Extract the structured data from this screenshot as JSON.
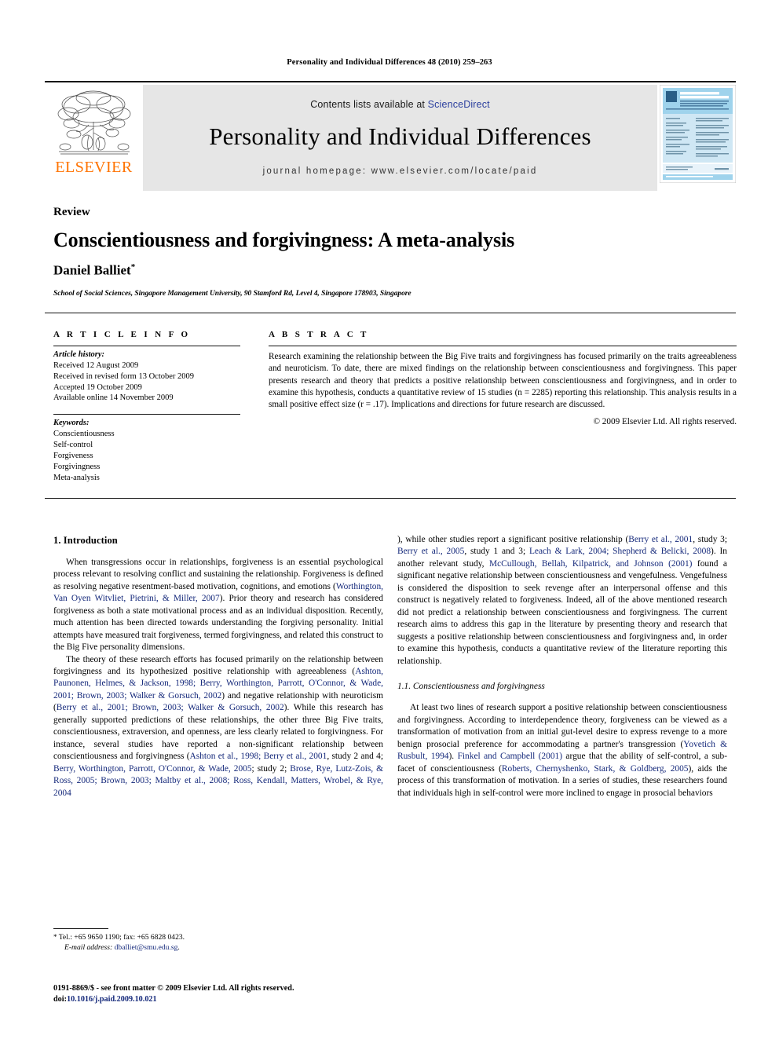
{
  "running_head": "Personality and Individual Differences 48 (2010) 259–263",
  "masthead": {
    "publisher_name": "ELSEVIER",
    "contents_prefix": "Contents lists available at ",
    "sciencedirect": "ScienceDirect",
    "journal_title": "Personality and Individual Differences",
    "homepage": "journal homepage: www.elsevier.com/locate/paid",
    "cover": {
      "title_line1": "PERSONALITY AND",
      "title_line2": "INDIVIDUAL DIFFERENCES",
      "accent_color": "#9fd3ec"
    }
  },
  "article": {
    "doc_type": "Review",
    "title": "Conscientiousness and forgivingness: A meta-analysis",
    "author": "Daniel Balliet",
    "author_marker": "*",
    "affiliation": "School of Social Sciences, Singapore Management University, 90 Stamford Rd, Level 4, Singapore 178903, Singapore"
  },
  "info": {
    "heading": "A R T I C L E   I N F O",
    "history_label": "Article history:",
    "history": [
      "Received 12 August 2009",
      "Received in revised form 13 October 2009",
      "Accepted 19 October 2009",
      "Available online 14 November 2009"
    ],
    "keywords_label": "Keywords:",
    "keywords": [
      "Conscientiousness",
      "Self-control",
      "Forgiveness",
      "Forgivingness",
      "Meta-analysis"
    ]
  },
  "abstract": {
    "heading": "A B S T R A C T",
    "text": "Research examining the relationship between the Big Five traits and forgivingness has focused primarily on the traits agreeableness and neuroticism. To date, there are mixed findings on the relationship between conscientiousness and forgivingness. This paper presents research and theory that predicts a positive relationship between conscientiousness and forgivingness, and in order to examine this hypothesis, conducts a quantitative review of 15 studies (n = 2285) reporting this relationship. This analysis results in a small positive effect size (r = .17). Implications and directions for future research are discussed.",
    "copyright": "© 2009 Elsevier Ltd. All rights reserved."
  },
  "body": {
    "section1_heading": "1. Introduction",
    "p1_a": "When transgressions occur in relationships, forgiveness is an essential psychological process relevant to resolving conflict and sustaining the relationship. Forgiveness is defined as resolving negative resentment-based motivation, cognitions, and emotions (",
    "p1_cite1": "Worthington, Van Oyen Witvliet, Pietrini, & Miller, 2007",
    "p1_b": "). Prior theory and research has considered forgiveness as both a state motivational process and as an individual disposition. Recently, much attention has been directed towards understanding the forgiving personality. Initial attempts have measured trait forgiveness, termed forgivingness, and related this construct to the Big Five personality dimensions.",
    "p2_a": "The theory of these research efforts has focused primarily on the relationship between forgivingness and its hypothesized positive relationship with agreeableness (",
    "p2_cite1": "Ashton, Paunonen, Helmes, & Jackson, 1998; Berry, Worthington, Parrott, O'Connor, & Wade, 2001; Brown, 2003; Walker & Gorsuch, 2002",
    "p2_b": ") and negative relationship with neuroticism (",
    "p2_cite2": "Berry et al., 2001; Brown, 2003; Walker & Gorsuch, 2002",
    "p2_c": "). While this research has generally supported predictions of these relationships, the other three Big Five traits, conscientiousness, extraversion, and openness, are less clearly related to forgivingness. For instance, several studies have reported a non-significant relationship between conscientiousness and forgivingness (",
    "p2_cite3": "Ashton et al., 1998; Berry et al., 2001",
    "p2_d": ", study 2 and 4; ",
    "p2_cite4": "Berry, Worthington, Parrott, O'Connor, & Wade, 2005",
    "p2_e": "; study 2; ",
    "p2_cite5": "Brose, Rye, Lutz-Zois, & Ross, 2005; Brown, 2003; Maltby et al., 2008; Ross, Kendall, Matters, Wrobel, & Rye, 2004",
    "p2_f": "), while other studies report a significant positive relationship (",
    "p2_cite6": "Berry et al., 2001",
    "p2_g": ", study 3; ",
    "p2_cite7": "Berry et al., 2005",
    "p2_h": ", study 1 and 3; ",
    "p2_cite8": "Leach & Lark, 2004; Shepherd & Belicki, 2008",
    "p2_i": "). In another relevant study, ",
    "p2_cite9": "McCullough, Bellah, Kilpatrick, and Johnson (2001)",
    "p2_j": " found a significant negative relationship between conscientiousness and vengefulness. Vengefulness is considered the disposition to seek revenge after an interpersonal offense and this construct is negatively related to forgiveness. Indeed, all of the above mentioned research did not predict a relationship between conscientiousness and forgivingness. The current research aims to address this gap in the literature by presenting theory and research that suggests a positive relationship between conscientiousness and forgivingness and, in order to examine this hypothesis, conducts a quantitative review of the literature reporting this relationship.",
    "section11_heading": "1.1. Conscientiousness and forgivingness",
    "p3_a": "At least two lines of research support a positive relationship between conscientiousness and forgivingness. According to interdependence theory, forgiveness can be viewed as a transformation of motivation from an initial gut-level desire to express revenge to a more benign prosocial preference for accommodating a partner's transgression (",
    "p3_cite1": "Yovetich & Rusbult, 1994",
    "p3_b": "). ",
    "p3_cite2": "Finkel and Campbell (2001)",
    "p3_c": " argue that the ability of self-control, a sub-facet of conscientiousness (",
    "p3_cite3": "Roberts, Chernyshenko, Stark, & Goldberg, 2005",
    "p3_d": "), aids the process of this transformation of motivation. In a series of studies, these researchers found that individuals high in self-control were more inclined to engage in prosocial behaviors"
  },
  "footnote": {
    "marker": "*",
    "tel": "Tel.: +65 9650 1190; fax: +65 6828 0423.",
    "email_label": "E-mail address:",
    "email": "dballiet@smu.edu.sg"
  },
  "footer": {
    "issn_line": "0191-8869/$ - see front matter © 2009 Elsevier Ltd. All rights reserved.",
    "doi_label": "doi:",
    "doi": "10.1016/j.paid.2009.10.021"
  }
}
